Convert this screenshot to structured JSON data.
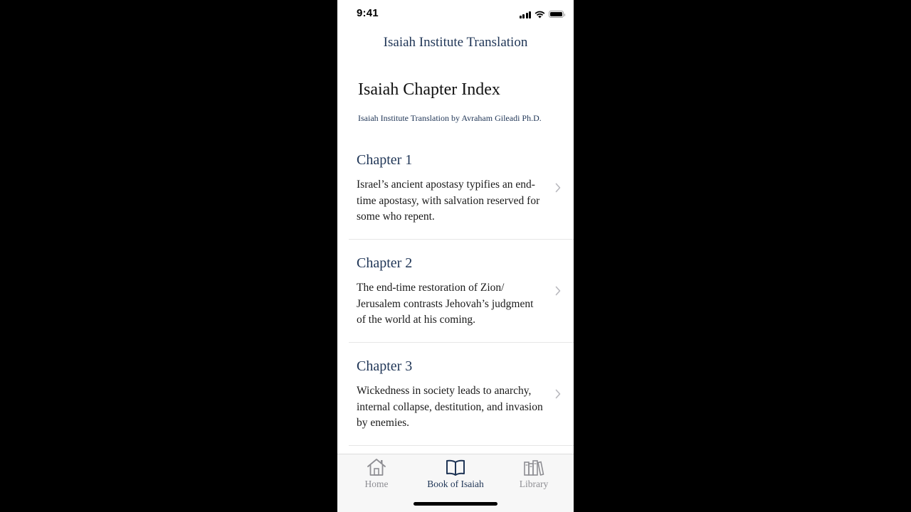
{
  "status_bar": {
    "time": "9:41"
  },
  "nav": {
    "title": "Isaiah Institute Translation"
  },
  "header": {
    "title": "Isaiah Chapter Index",
    "subtitle": "Isaiah Institute Translation by Avraham Gileadi Ph.D."
  },
  "chapters": [
    {
      "title": "Chapter 1",
      "description": "Israel’s ancient apostasy typifies an end-time apostasy, with salvation reserved for some who repent."
    },
    {
      "title": "Chapter 2",
      "description": "The end-time restoration of Zion/ Jerusalem contrasts Jehovah’s judgment of the world at his coming."
    },
    {
      "title": "Chapter 3",
      "description": "Wickedness in society leads to anarchy, internal collapse, destitution, and invasion by enemies."
    }
  ],
  "tab_bar": {
    "tabs": [
      {
        "label": "Home",
        "icon": "home-icon",
        "active": false
      },
      {
        "label": "Book of Isaiah",
        "icon": "open-book-icon",
        "active": true
      },
      {
        "label": "Library",
        "icon": "library-books-icon",
        "active": false
      }
    ]
  },
  "colors": {
    "accent_navy": "#1f3556",
    "inactive_gray": "#8e8e93",
    "background": "#ffffff",
    "tab_bar_bg": "#f7f7f7"
  }
}
